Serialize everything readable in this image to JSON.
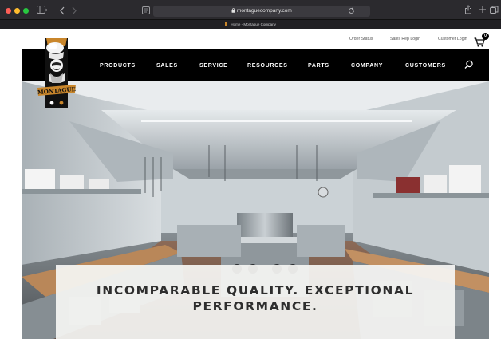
{
  "browser": {
    "url": "montaguecompany.com",
    "tab_title": "Home - Montague Company"
  },
  "utility_nav": {
    "order_status": "Order Status",
    "sales_rep_login": "Sales Rep Login",
    "customer_login": "Customer Login",
    "cart_count": "0"
  },
  "logo": {
    "text": "MONTAGUE"
  },
  "main_nav": {
    "items": [
      "PRODUCTS",
      "SALES",
      "SERVICE",
      "RESOURCES",
      "PARTS",
      "COMPANY",
      "CUSTOMERS"
    ]
  },
  "hero": {
    "headline_line1": "INCOMPARABLE QUALITY. EXCEPTIONAL",
    "headline_line2": "PERFORMANCE."
  },
  "colors": {
    "nav_background": "#000000",
    "chrome_background": "#2b2a2e",
    "traffic_red": "#fe5f57",
    "traffic_yellow": "#febc2e",
    "traffic_green": "#28c840",
    "logo_accent": "#c9862b"
  },
  "icons": {
    "sidebar": "sidebar-icon",
    "back": "chevron-left-icon",
    "forward": "chevron-right-icon",
    "reader": "reader-icon",
    "lock": "lock-icon",
    "reload": "reload-icon",
    "share": "share-icon",
    "new_tab": "plus-icon",
    "tabs": "tabs-icon",
    "cart": "cart-icon",
    "search": "search-icon"
  }
}
